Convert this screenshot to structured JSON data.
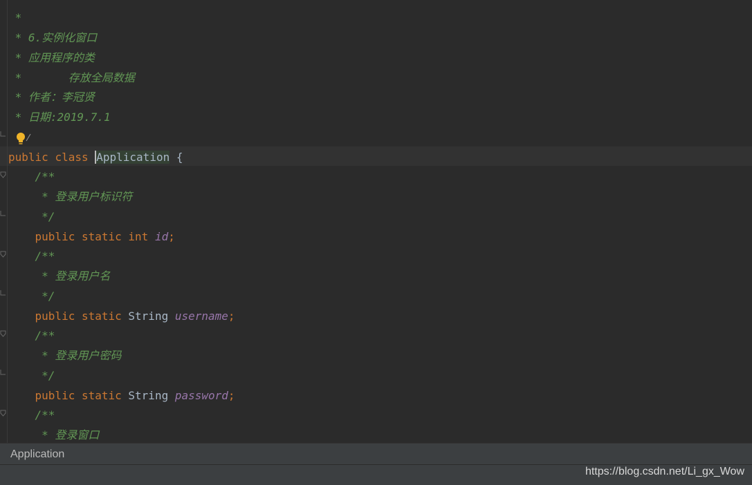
{
  "code": {
    "lines": {
      "l0": " *",
      "l1": " * 6.实例化窗口",
      "l2": " * 应用程序的类",
      "l3": " *       存放全局数据",
      "l4": " * 作者：李冠贤",
      "l5": " * 日期:2019.7.1",
      "l7_kw1": "public",
      "l7_kw2": "class",
      "l7_name": "Application",
      "l7_brace": " {",
      "l8": "    /**",
      "l9": "     * 登录用户标识符",
      "l10": "     */",
      "l11_kw1": "public",
      "l11_kw2": "static",
      "l11_kw3": "int",
      "l11_field": "id",
      "l12": "    /**",
      "l13": "     * 登录用户名",
      "l14": "     */",
      "l15_kw1": "public",
      "l15_kw2": "static",
      "l15_type": "String",
      "l15_field": "username",
      "l16": "    /**",
      "l17": "     * 登录用户密码",
      "l18": "     */",
      "l19_kw1": "public",
      "l19_kw2": "static",
      "l19_type": "String",
      "l19_field": "password",
      "l20": "    /**",
      "l21": "     * 登录窗口"
    },
    "semicolon": ";",
    "intention_icon": "lightbulb-icon"
  },
  "breadcrumb": {
    "item": "Application"
  },
  "status": {
    "watermark": "https://blog.csdn.net/Li_gx_Wow"
  },
  "colors": {
    "background": "#2b2b2b",
    "comment": "#629755",
    "keyword": "#cc7832",
    "field": "#9876aa",
    "text": "#a9b7c6"
  }
}
